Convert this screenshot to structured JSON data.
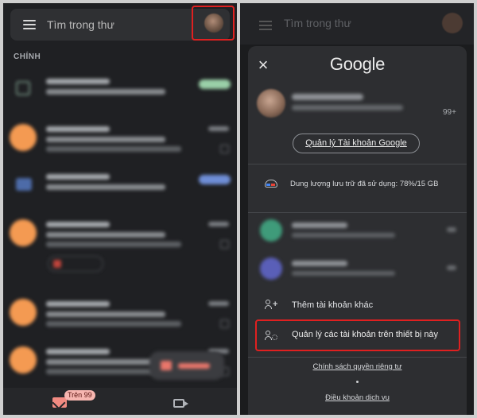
{
  "inbox": {
    "search_placeholder": "Tìm trong thư",
    "section_label": "CHÍNH",
    "badge": "Trên 99"
  },
  "account_sheet": {
    "logo": "Google",
    "account_count": "99+",
    "manage_account_label": "Quản lý Tài khoản Google",
    "storage_text": "Dung lượng lưu trữ đã sử dụng: 78%/15 GB",
    "add_account_label": "Thêm tài khoản khác",
    "manage_devices_label": "Quản lý các tài khoản trên thiết bị này",
    "privacy_link": "Chính sách quyền riêng tư",
    "terms_link": "Điều khoản dịch vụ",
    "background_search_placeholder": "Tìm trong thư"
  },
  "colors": {
    "highlight_border": "#e02020",
    "mail_accent": "#f28b82",
    "avatar_orange": "#f49a52"
  },
  "icons": [
    "menu-icon",
    "avatar",
    "mail-icon",
    "video-icon",
    "close-icon",
    "cloud-icon",
    "add-person-icon",
    "manage-accounts-icon"
  ]
}
